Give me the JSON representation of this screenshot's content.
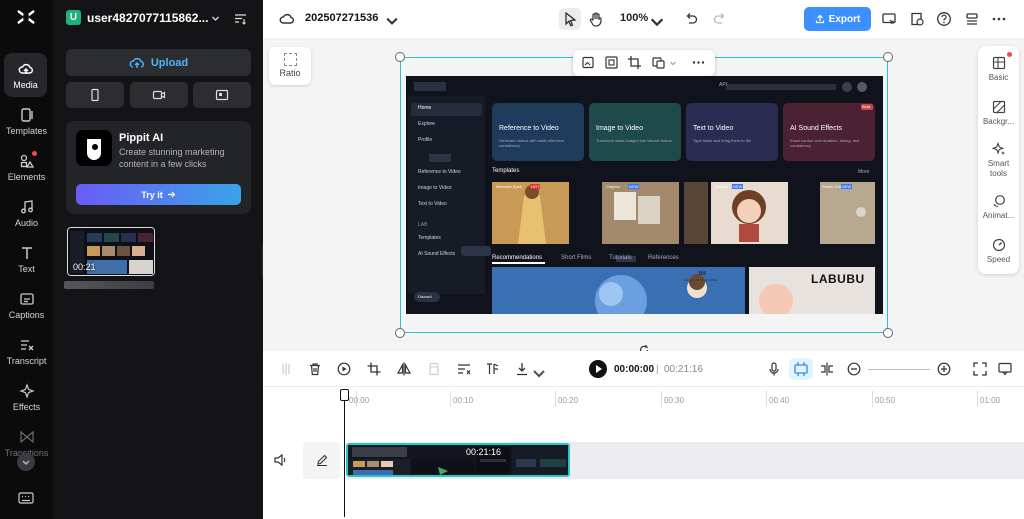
{
  "rail": {
    "items": [
      {
        "label": "Media"
      },
      {
        "label": "Templates"
      },
      {
        "label": "Elements"
      },
      {
        "label": "Audio"
      },
      {
        "label": "Text"
      },
      {
        "label": "Captions"
      },
      {
        "label": "Transcript"
      },
      {
        "label": "Effects"
      },
      {
        "label": "Transitions"
      }
    ]
  },
  "panel": {
    "user_initial": "U",
    "username": "user4827077115862...",
    "upload_label": "Upload",
    "promo": {
      "title": "Pippit AI",
      "description": "Create stunning marketing content in a few clicks",
      "cta": "Try it"
    },
    "media": [
      {
        "duration": "00:21"
      }
    ]
  },
  "topbar": {
    "project_name": "202507271536",
    "zoom": "100%",
    "export_label": "Export"
  },
  "stage": {
    "ratio_label": "Ratio",
    "video": {
      "api_label": "API",
      "nav": [
        "Home",
        "Explore",
        "Profile",
        "Reference to Video",
        "Image to Video",
        "Text to Video",
        "LAB",
        "Templates",
        "AI Sound Effects"
      ],
      "cards": [
        {
          "title": "Reference to Video",
          "desc": "Generate videos with multi-reference consistency"
        },
        {
          "title": "Image to Video",
          "desc": "Transform static images into vibrant videos"
        },
        {
          "title": "Text to Video",
          "desc": "Type ideas and bring them to life"
        },
        {
          "title": "AI Sound Effects",
          "desc": "Exact control over duration, timing, and consistency",
          "badge": "Beta"
        }
      ],
      "templates_heading": "Templates",
      "more": "More",
      "templates": [
        {
          "name": "Mermaid Spell",
          "badge": "HOT"
        },
        {
          "name": "Claymix",
          "badge": "NEW"
        },
        {
          "name": "",
          "badge": ""
        },
        {
          "name": "AniMoji",
          "badge": "NEW"
        },
        {
          "name": "Punch Out",
          "badge": "NEW"
        }
      ],
      "tabs": [
        "Recommendations",
        "Short Films",
        "Tutorials",
        "References"
      ],
      "profile": {
        "name": "Bill",
        "handle": "aka @ILPROFILE.NAME"
      },
      "poster_text": "LABUBU",
      "footer_label": "Discord"
    }
  },
  "right_panel": {
    "items": [
      {
        "label": "Basic"
      },
      {
        "label": "Backgr..."
      },
      {
        "label": "Smart tools"
      },
      {
        "label": "Animat..."
      },
      {
        "label": "Speed"
      }
    ]
  },
  "timeline": {
    "current_time": "00:00:00",
    "separator": "|",
    "duration": "00:21:16",
    "ticks": [
      "00:00",
      "00:10",
      "00:20",
      "00:30",
      "00:40",
      "00:50",
      "01:00"
    ],
    "clip_duration": "00:21:16"
  },
  "colors": {
    "accent": "#3b8fff",
    "selection": "#25c6c8",
    "rail_bg": "#0b0b0c",
    "panel_bg": "#141416"
  }
}
